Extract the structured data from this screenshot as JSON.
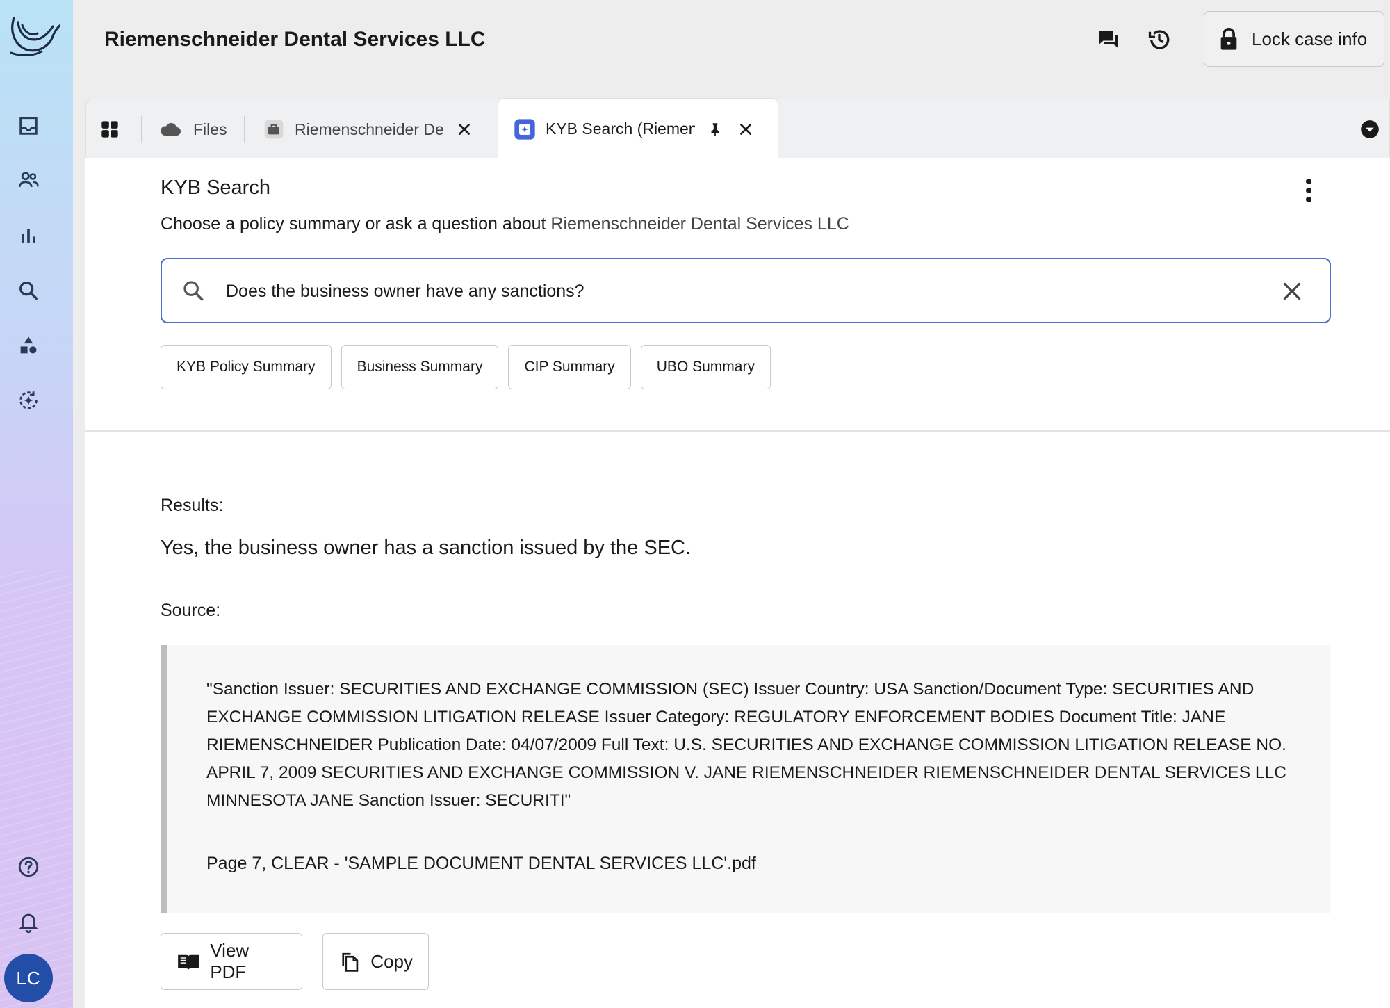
{
  "header": {
    "case_title": "Riemenschneider Dental Services LLC",
    "lock_label": "Lock case info"
  },
  "tabs": [
    {
      "label": "Files",
      "icon": "cloud-icon"
    },
    {
      "label": "Riemenschneider De",
      "icon": "briefcase-icon"
    },
    {
      "label": "KYB Search (Riemen",
      "icon": "kyb-search-icon",
      "active": true
    }
  ],
  "panel": {
    "title": "KYB Search",
    "subtitle_prefix": "Choose a policy summary or ask a question about ",
    "subtitle_company": "Riemenschneider Dental Services LLC",
    "search_value": "Does the business owner have any sanctions?",
    "chips": [
      "KYB Policy Summary",
      "Business Summary",
      "CIP Summary",
      "UBO Summary"
    ]
  },
  "results": {
    "label": "Results:",
    "answer": "Yes, the business owner has a sanction issued by the SEC.",
    "source_label": "Source:",
    "quote": "\"Sanction Issuer: SECURITIES AND EXCHANGE COMMISSION (SEC) Issuer Country: USA Sanction/Document Type: SECURITIES AND EXCHANGE COMMISSION LITIGATION RELEASE Issuer Category: REGULATORY ENFORCEMENT BODIES Document Title: JANE RIEMENSCHNEIDER Publication Date: 04/07/2009 Full Text: U.S. SECURITIES AND EXCHANGE COMMISSION LITIGATION RELEASE NO. APRIL 7, 2009 SECURITIES AND EXCHANGE COMMISSION V. JANE RIEMENSCHNEIDER RIEMENSCHNEIDER DENTAL SERVICES LLC MINNESOTA JANE Sanction Issuer: SECURITI\"",
    "reference": "Page 7, CLEAR - 'SAMPLE DOCUMENT DENTAL SERVICES LLC'.pdf",
    "view_pdf_label": "View PDF",
    "copy_label": "Copy"
  },
  "user": {
    "initials": "LC"
  },
  "colors": {
    "accent": "#4a6fd0",
    "avatar": "#234ea8",
    "kyb_tab_icon": "#4466dd"
  }
}
